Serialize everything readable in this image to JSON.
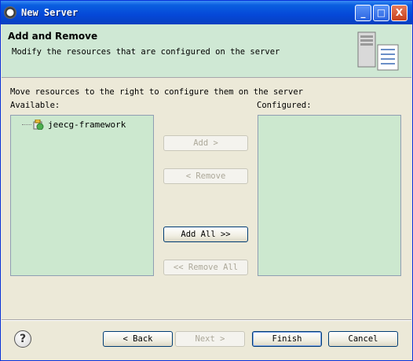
{
  "window": {
    "title": "New Server",
    "controls": {
      "minimize": "_",
      "maximize": "□",
      "close": "X"
    }
  },
  "header": {
    "title": "Add and Remove",
    "description": "Modify the resources that are configured on the server",
    "icon": "server-icon"
  },
  "main": {
    "instruction": "Move resources to the right to configure them on the server",
    "available_label": "Available:",
    "configured_label": "Configured:",
    "available_items": [
      {
        "label": "jeecg-framework",
        "icon": "web-project-icon"
      }
    ],
    "configured_items": [],
    "buttons": {
      "add": "Add >",
      "remove": "< Remove",
      "add_all": "Add All >>",
      "remove_all": "<< Remove All"
    }
  },
  "footer": {
    "help_icon": "?",
    "back": "< Back",
    "next": "Next >",
    "finish": "Finish",
    "cancel": "Cancel"
  }
}
